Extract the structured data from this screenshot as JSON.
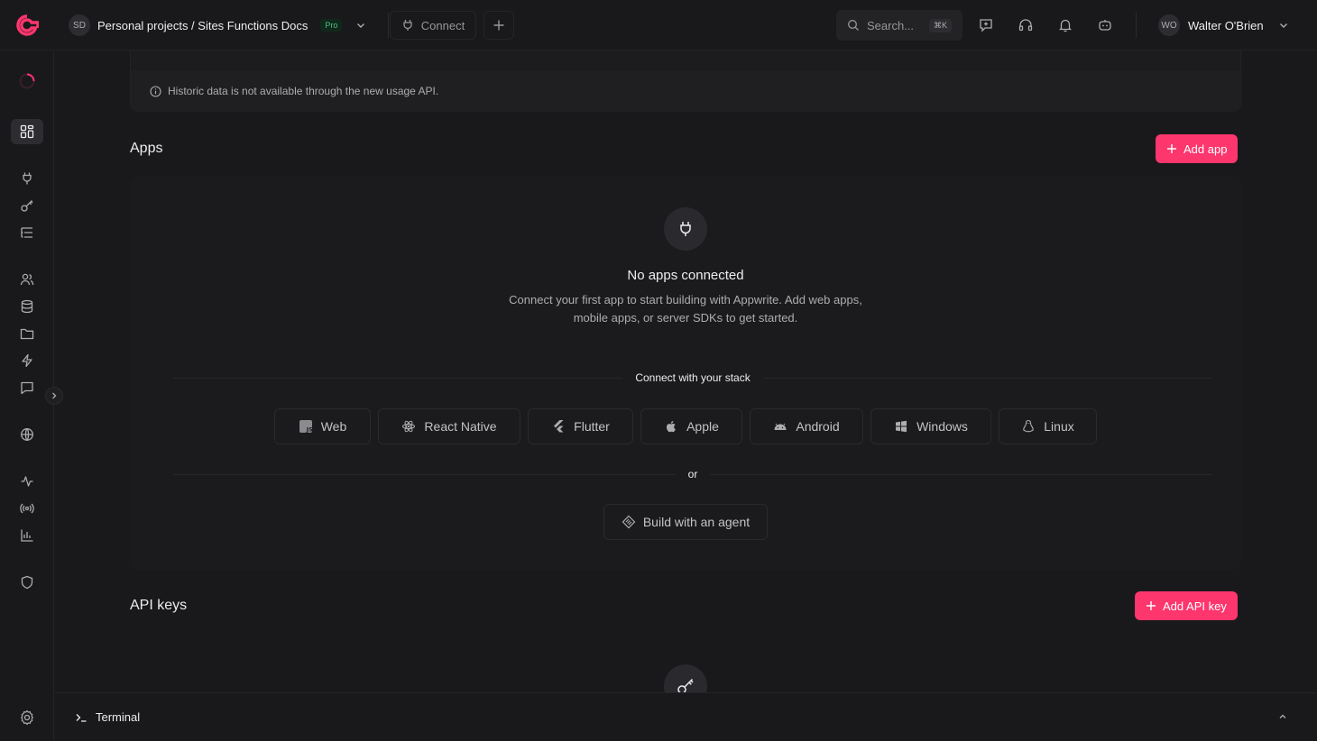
{
  "header": {
    "project_avatar": "SD",
    "breadcrumb": "Personal projects / Sites Functions Docs",
    "plan_badge": "Pro",
    "connect_label": "Connect",
    "search_placeholder": "Search...",
    "search_shortcut": "⌘K",
    "user_avatar": "WO",
    "user_name": "Walter O'Brien"
  },
  "notice": {
    "text": "Historic data is not available through the new usage API."
  },
  "apps": {
    "title": "Apps",
    "add_label": "Add app",
    "empty_title": "No apps connected",
    "empty_desc": "Connect your first app to start building with Appwrite. Add web apps, mobile apps, or server SDKs to get started.",
    "stack_label": "Connect with your stack",
    "platforms": [
      {
        "label": "Web",
        "icon": "web-js-icon"
      },
      {
        "label": "React Native",
        "icon": "react-icon"
      },
      {
        "label": "Flutter",
        "icon": "flutter-icon"
      },
      {
        "label": "Apple",
        "icon": "apple-icon"
      },
      {
        "label": "Android",
        "icon": "android-icon"
      },
      {
        "label": "Windows",
        "icon": "windows-icon"
      },
      {
        "label": "Linux",
        "icon": "linux-icon"
      }
    ],
    "or_label": "or",
    "agent_label": "Build with an agent"
  },
  "api_keys": {
    "title": "API keys",
    "add_label": "Add API key"
  },
  "terminal": {
    "label": "Terminal"
  },
  "colors": {
    "accent": "#fd366e",
    "background": "#19191c",
    "card": "#1b1b1e"
  }
}
